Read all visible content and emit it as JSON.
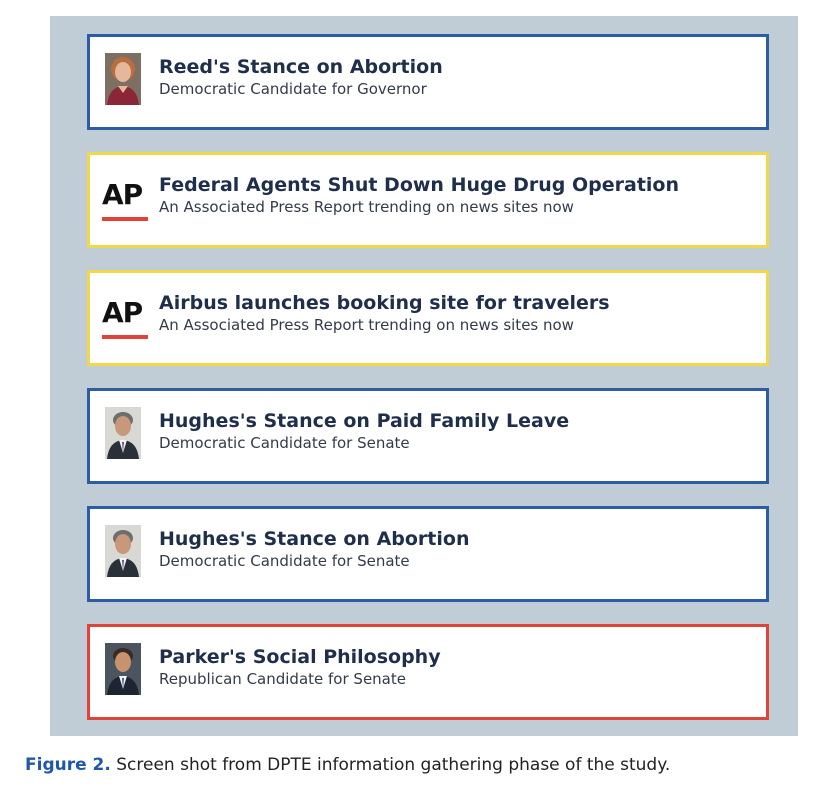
{
  "feed": {
    "items": [
      {
        "kind": "candidate",
        "party": "democrat",
        "border_color": "#2c5ca3",
        "icon": "candidate-photo-icon",
        "title": "Reed's Stance on Abortion",
        "subtitle": "Democratic Candidate for Governor"
      },
      {
        "kind": "news",
        "border_color": "#f0d84a",
        "icon": "ap-logo-icon",
        "logo_text": "AP",
        "title": "Federal Agents Shut Down Huge Drug Operation",
        "subtitle": "An Associated Press Report trending on news sites now"
      },
      {
        "kind": "news",
        "border_color": "#f0d84a",
        "icon": "ap-logo-icon",
        "logo_text": "AP",
        "title": "Airbus launches booking site for travelers",
        "subtitle": "An Associated Press Report trending on news sites now"
      },
      {
        "kind": "candidate",
        "party": "democrat",
        "border_color": "#2c5ca3",
        "icon": "candidate-photo-icon",
        "title": "Hughes's Stance on Paid Family Leave",
        "subtitle": "Democratic Candidate for Senate"
      },
      {
        "kind": "candidate",
        "party": "democrat",
        "border_color": "#2c5ca3",
        "icon": "candidate-photo-icon",
        "title": "Hughes's Stance on Abortion",
        "subtitle": "Democratic Candidate for Senate"
      },
      {
        "kind": "candidate",
        "party": "republican",
        "border_color": "#e0423c",
        "icon": "candidate-photo-icon",
        "title": "Parker's Social Philosophy",
        "subtitle": "Republican Candidate for Senate"
      }
    ]
  },
  "caption": {
    "label": "Figure 2.",
    "text": " Screen shot from DPTE information gathering phase of the study."
  },
  "colors": {
    "screen_background": "#c1cdd6",
    "democrat_border": "#2c5ca3",
    "republican_border": "#e0423c",
    "news_border": "#f0d84a",
    "ap_underline": "#e0423c",
    "caption_label": "#1f58a8"
  }
}
